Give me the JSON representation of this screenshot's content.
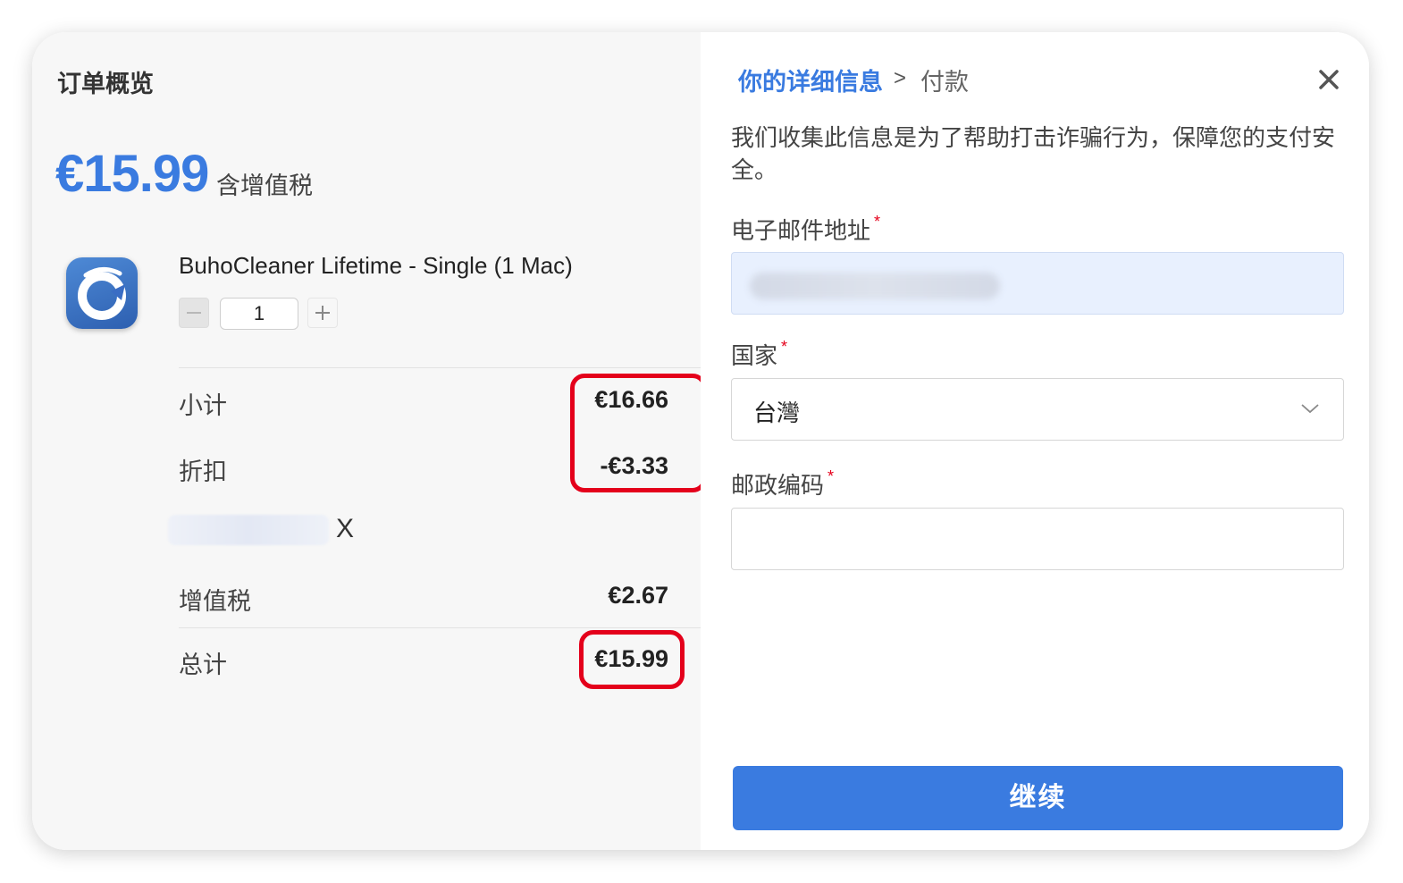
{
  "order_summary": {
    "title": "订单概览",
    "price": "€15.99",
    "tax_note": "含增值税",
    "product": {
      "icon": "buhocleaner-app-icon",
      "name": "BuhoCleaner Lifetime - Single (1 Mac)",
      "quantity": "1"
    },
    "rows": {
      "subtotal_label": "小计",
      "subtotal_value": "€16.66",
      "discount_label": "折扣",
      "discount_value": "-€3.33",
      "coupon_remove": "X",
      "vat_label": "增值税",
      "vat_value": "€2.67",
      "total_label": "总计",
      "total_value": "€15.99"
    }
  },
  "checkout": {
    "breadcrumb": {
      "current": "你的详细信息",
      "separator": ">",
      "next": "付款"
    },
    "close_icon": "close-icon",
    "info": "我们收集此信息是为了帮助打击诈骗行为，保障您的支付安全。",
    "email": {
      "label": "电子邮件地址",
      "required": "*"
    },
    "country": {
      "label": "国家",
      "required": "*",
      "value": "台灣"
    },
    "postal": {
      "label": "邮政编码",
      "required": "*"
    },
    "continue_label": "继续"
  },
  "colors": {
    "accent": "#3a7be0",
    "highlight": "#e4001b",
    "required": "#e4001b"
  }
}
